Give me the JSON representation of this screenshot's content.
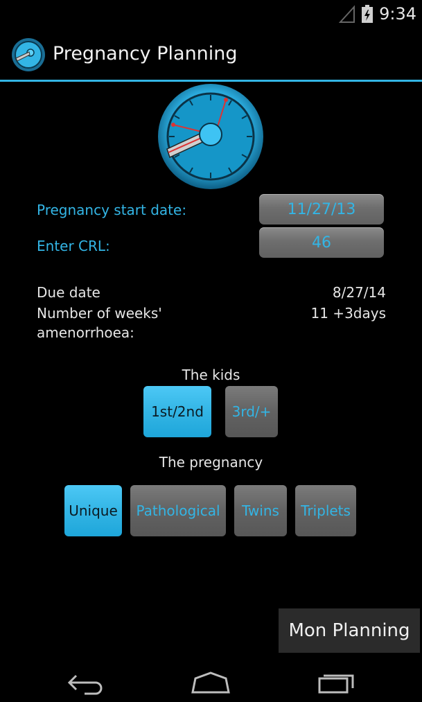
{
  "status_bar": {
    "time": "9:34"
  },
  "app": {
    "title": "Pregnancy Planning"
  },
  "form": {
    "start_date_label": "Pregnancy start date:",
    "start_date_value": "11/27/13",
    "crl_label": "Enter CRL:",
    "crl_value": "46"
  },
  "results": {
    "due_date_label": "Due date",
    "due_date_value": "8/27/14",
    "weeks_label_line1": "Number of weeks'",
    "weeks_label_line2": "amenorrhoea:",
    "weeks_value": "11 +3days"
  },
  "kids": {
    "title": "The kids",
    "options": [
      {
        "label": "1st/2nd",
        "selected": true
      },
      {
        "label": "3rd/+",
        "selected": false
      }
    ]
  },
  "pregnancy": {
    "title": "The pregnancy",
    "options": [
      {
        "label": "Unique",
        "selected": true
      },
      {
        "label": "Pathological",
        "selected": false
      },
      {
        "label": "Twins",
        "selected": false
      },
      {
        "label": "Triplets",
        "selected": false
      }
    ]
  },
  "action": {
    "mon_planning_label": "Mon Planning"
  },
  "colors": {
    "accent": "#33b5e5",
    "background": "#000000",
    "button_gray": "#6b6b6b"
  },
  "icons": [
    "signal-icon",
    "battery-icon",
    "app-gauge-icon",
    "back-icon",
    "home-icon",
    "recents-icon"
  ]
}
